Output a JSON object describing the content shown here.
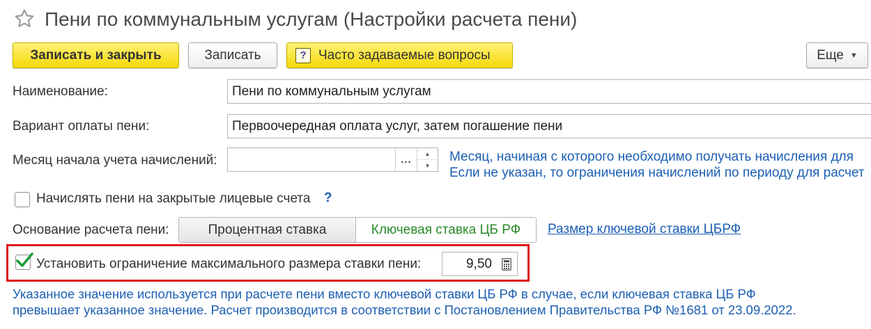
{
  "window": {
    "title": "Пени по коммунальным услугам (Настройки расчета пени)",
    "favorite_icon": "star-outline-icon"
  },
  "toolbar": {
    "save_close_label": "Записать и закрыть",
    "save_label": "Записать",
    "faq_label": "Часто задаваемые вопросы",
    "faq_icon": "question-box-icon",
    "faq_icon_glyph": "?",
    "more_label": "Еще",
    "more_icon": "caret-down-icon"
  },
  "form": {
    "name": {
      "label": "Наименование:",
      "value": "Пени по коммунальным услугам"
    },
    "payment_variant": {
      "label": "Вариант оплаты пени:",
      "value": "Первоочередная оплата услуг, затем погашение пени"
    },
    "start_month": {
      "label": "Месяц начала учета начислений:",
      "value": "",
      "select_label": "...",
      "hint_line1": "Месяц, начиная с которого необходимо получать начисления для",
      "hint_line2": "Если не указан, то ограничения начислений по периоду для расчет"
    },
    "closed_accounts": {
      "label": "Начислять пени на закрытые лицевые счета",
      "checked": false,
      "help": "?"
    },
    "calc_basis": {
      "label": "Основание расчета пени:",
      "options": [
        "Процентная ставка",
        "Ключевая ставка ЦБ РФ"
      ],
      "selected": "Ключевая ставка ЦБ РФ",
      "link": "Размер ключевой ставки ЦБРФ"
    },
    "max_rate": {
      "label": "Установить ограничение максимального размера ставки пени:",
      "checked": true,
      "value": "9,50",
      "calc_icon": "calculator-icon"
    },
    "note_line1": "Указанное значение используется при расчете пени вместо ключевой ставки ЦБ РФ в случае, если ключевая ставка ЦБ РФ",
    "note_line2": "превышает указанное значение. Расчет производится в соответствии с Постановлением Правительства РФ №1681 от 23.09.2022."
  },
  "colors": {
    "accent_yellow": "#f5d90a",
    "link_blue": "#1c5fb3",
    "selected_green": "#2a8a2a",
    "highlight_red": "#e0141c",
    "check_green": "#1e9e3a"
  }
}
